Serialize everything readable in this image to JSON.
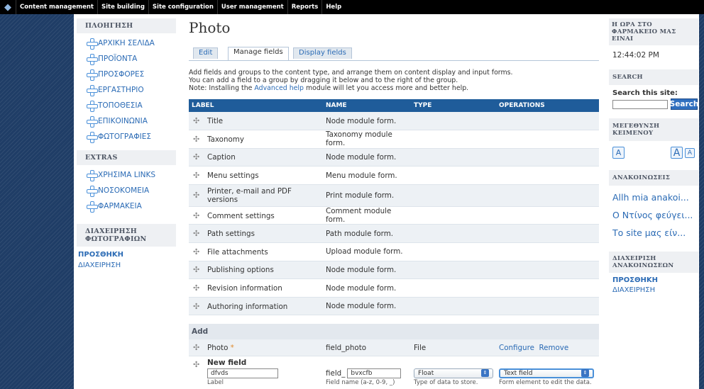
{
  "adminbar": {
    "items": [
      "Content management",
      "Site building",
      "Site configuration",
      "User management",
      "Reports",
      "Help"
    ]
  },
  "left": {
    "nav_title": "ΠΛΟΗΓΗΣΗ",
    "nav_items": [
      "ΑΡΧΙΚΗ ΣΕΛΙΔΑ",
      "ΠΡΟΪΟΝΤΑ",
      "ΠΡΟΣΦΟΡΕΣ",
      "ΕΡΓΑΣΤΗΡΙΟ",
      "ΤΟΠΟΘΕΣΙΑ",
      "ΕΠΙΚΟΙΝΩΝΙΑ",
      "ΦΩΤΟΓΡΑΦΙΕΣ"
    ],
    "extras_title": "EXTRAS",
    "extras_items": [
      "ΧΡΗΣΙΜΑ LINKS",
      "ΝΟΣΟΚΟΜΕΙΑ",
      "ΦΑΡΜΑΚΕΙΑ"
    ],
    "photo_admin_title": "ΔΙΑΧΕΙΡΗΣΗ ΦΩΤΟΓΡΑΦΙΩΝ",
    "photo_admin_add": "ΠΡΟΣΘΗΚΗ",
    "photo_admin_manage": "ΔΙΑΧΕΙΡΗΣΗ"
  },
  "main": {
    "title": "Photo",
    "tabs": [
      "Edit",
      "Manage fields",
      "Display fields"
    ],
    "active_tab": "Manage fields",
    "help_line1": "Add fields and groups to the content type, and arrange them on content display and input forms.",
    "help_line2": "You can add a field to a group by dragging it below and to the right of the group.",
    "help_line3_pre": "Note: Installing the ",
    "help_line3_link": "Advanced help",
    "help_line3_post": " module will let you access more and better help.",
    "columns": [
      "LABEL",
      "NAME",
      "TYPE",
      "OPERATIONS"
    ],
    "rows": [
      {
        "label": "Title",
        "name": "Node module form."
      },
      {
        "label": "Taxonomy",
        "name": "Taxonomy module form."
      },
      {
        "label": "Caption",
        "name": "Node module form."
      },
      {
        "label": "Menu settings",
        "name": "Menu module form."
      },
      {
        "label": "Printer, e-mail and PDF versions",
        "name": "Print module form."
      },
      {
        "label": "Comment settings",
        "name": "Comment module form."
      },
      {
        "label": "Path settings",
        "name": "Path module form."
      },
      {
        "label": "File attachments",
        "name": "Upload module form."
      },
      {
        "label": "Publishing options",
        "name": "Node module form."
      },
      {
        "label": "Revision information",
        "name": "Node module form."
      },
      {
        "label": "Authoring information",
        "name": "Node module form."
      }
    ],
    "add": {
      "heading": "Add",
      "photo_label": "Photo",
      "photo_required": "*",
      "photo_name": "field_photo",
      "photo_type": "File",
      "configure": "Configure",
      "remove": "Remove",
      "new_field_title": "New field",
      "label_value": "dfvds",
      "label_hint": "Label",
      "name_prefix": "field_",
      "name_value": "bvxcfb",
      "name_hint": "Field name (a-z, 0-9, _)",
      "type_value": "Float",
      "type_hint": "Type of data to store.",
      "widget_value": "Text field",
      "widget_hint": "Form element to edit the data."
    }
  },
  "right": {
    "clock_title": "Η ΩΡΑ ΣΤΟ ΦΑΡΜΑΚΕΙΟ ΜΑΣ ΕΙΝΑΙ",
    "clock_value": "12:44:02 PM",
    "search_title": "SEARCH",
    "search_label": "Search this site:",
    "search_button": "Search",
    "font_title": "ΜΕΓΕΘΥΝΣΗ ΚΕΙΜΕΝΟΥ",
    "font_letter": "A",
    "news_title": "ΑΝΑΚΟΙΝΩΣΕΙΣ",
    "news_items": [
      "Allh mia anakoi...",
      "Ο Ντίνος φεύγει...",
      "Το site μας είν..."
    ],
    "news_admin_title": "ΔΙΑΧΕΙΡΙΣΗ ΑΝΑΚΟΙΝΩΣΕΩΝ",
    "news_admin_add": "ΠΡΟΣΘΗΚΗ",
    "news_admin_manage": "ΔΙΑΧΕΙΡΗΣΗ"
  }
}
